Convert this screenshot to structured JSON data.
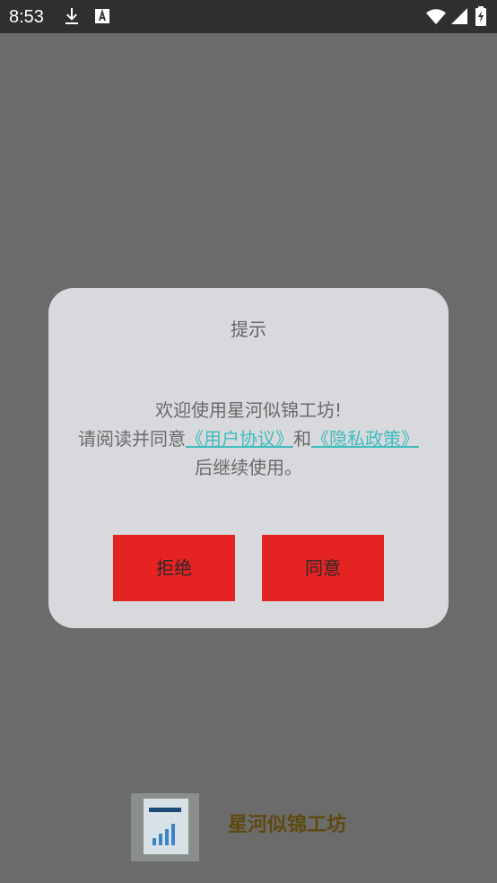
{
  "status_bar": {
    "time": "8:53",
    "icons": [
      "download-icon",
      "accessibility-a-icon",
      "wifi-icon",
      "cell-signal-icon",
      "battery-icon"
    ]
  },
  "dialog": {
    "title": "提示",
    "message_line1": "欢迎使用星河似锦工坊!",
    "message_pre": "请阅读并同意",
    "user_agreement_link": "《用户协议》",
    "and_text": "和",
    "privacy_policy_link": "《隐私政策》",
    "message_post": "后继续使用。",
    "reject_label": "拒绝",
    "agree_label": "同意",
    "link_color": "#3fbdbd",
    "button_color": "#e62323"
  },
  "splash": {
    "app_name": "星河似锦工坊"
  }
}
